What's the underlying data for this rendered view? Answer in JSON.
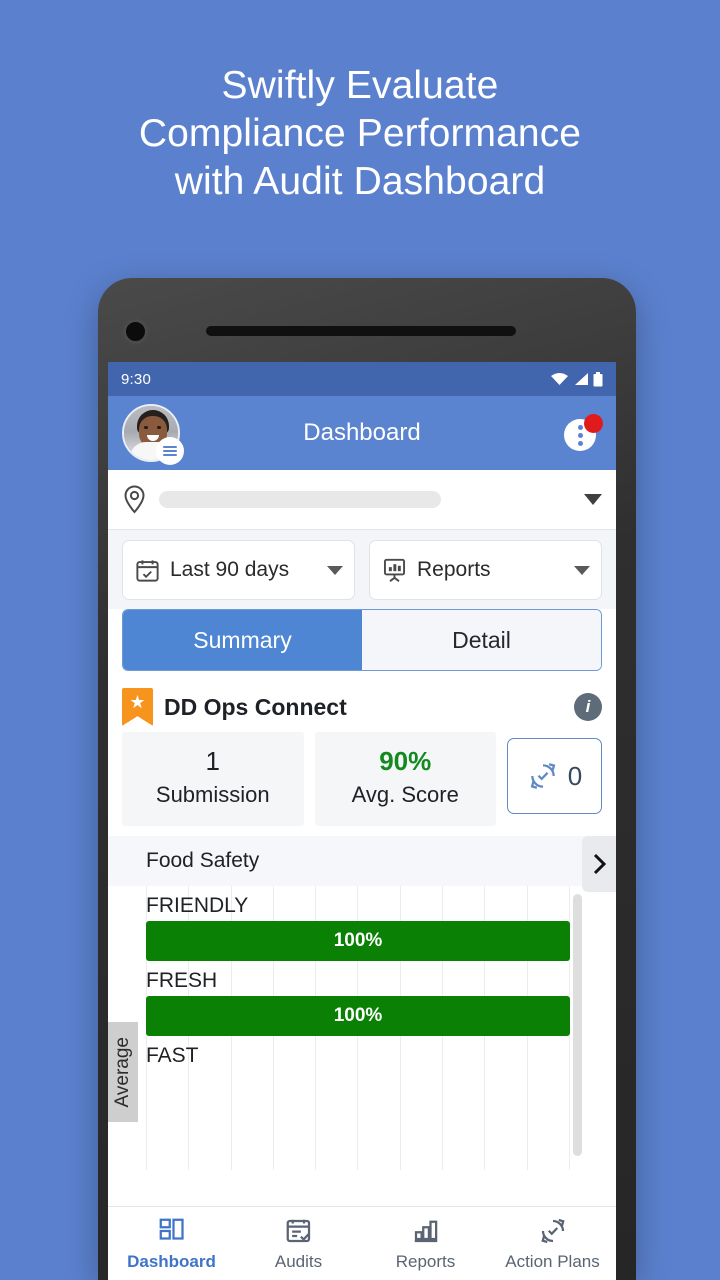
{
  "background_color": "#5B81CE",
  "headline": {
    "line1": "Swiftly Evaluate",
    "line2": "Compliance Performance",
    "line3": "with Audit Dashboard"
  },
  "phone": {
    "status_bar": {
      "time": "9:30",
      "icons": [
        "wifi-icon",
        "cellular-signal-icon",
        "battery-icon"
      ]
    },
    "app_bar": {
      "title": "Dashboard",
      "avatar": "user-avatar",
      "menu_badge": "hamburger-menu-icon",
      "overflow": "more-vertical-icon",
      "notification_badge_color": "#E11B1B",
      "background_color": "#5B84D0"
    },
    "location_selector": {
      "icon": "location-pin-icon",
      "value": "",
      "placeholder": "",
      "dropdown": "chevron-down-icon"
    },
    "filters": [
      {
        "icon": "calendar-icon",
        "label": "Last 90 days"
      },
      {
        "icon": "reports-board-icon",
        "label": "Reports"
      }
    ],
    "tabs": [
      {
        "label": "Summary",
        "active": true
      },
      {
        "label": "Detail",
        "active": false
      }
    ],
    "card": {
      "title": "DD Ops Connect",
      "badge_icon": "star-bookmark-icon",
      "badge_color": "#F7941E",
      "info_icon": "info-icon",
      "stats": [
        {
          "value": "1",
          "label": "Submission"
        },
        {
          "value": "90%",
          "label": "Avg. Score",
          "color": "#128A20"
        }
      ],
      "action_plans_chip": {
        "icon": "action-plans-icon",
        "count": "0"
      }
    },
    "next_button": "chevron-right-icon",
    "bottom_nav": [
      {
        "label": "Dashboard",
        "icon": "dashboard-grid-icon",
        "active": true
      },
      {
        "label": "Audits",
        "icon": "audit-checklist-icon",
        "active": false
      },
      {
        "label": "Reports",
        "icon": "bar-chart-icon",
        "active": false
      },
      {
        "label": "Action Plans",
        "icon": "action-plans-icon",
        "active": false
      }
    ]
  },
  "chart_data": {
    "type": "bar",
    "title": "Food Safety",
    "orientation": "horizontal",
    "axis_label": "Average",
    "categories": [
      "FRIENDLY",
      "FRESH",
      "FAST"
    ],
    "values": [
      100,
      100,
      null
    ],
    "value_labels": [
      "100%",
      "100%",
      ""
    ],
    "bar_color": "#0A8005",
    "xlim": [
      0,
      100
    ],
    "xlabel": "",
    "ylabel": "",
    "grid": true,
    "gridline_count": 11,
    "legend": "none"
  }
}
